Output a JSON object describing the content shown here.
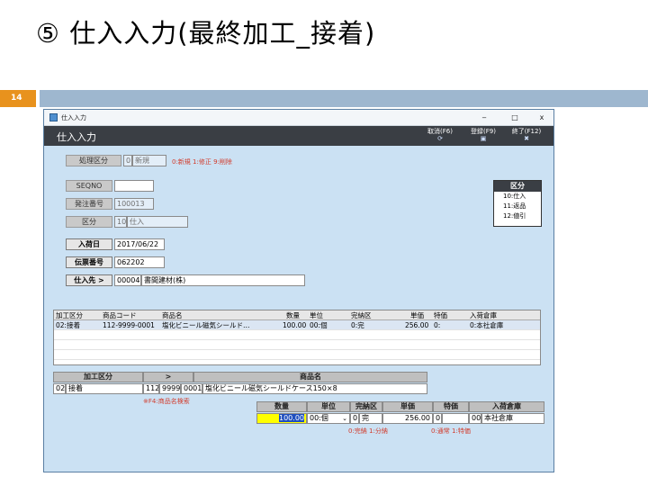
{
  "slide": {
    "title": "⑤ 仕入入力(最終加工_接着)",
    "page_number": "14"
  },
  "window": {
    "title": "仕入入力",
    "minimize": "‒",
    "maximize": "□",
    "close": "x"
  },
  "header": {
    "screen_title": "仕入入力",
    "keys": [
      {
        "label": "取消(F6)",
        "icon": "⟳"
      },
      {
        "label": "登録(F9)",
        "icon": "▣"
      },
      {
        "label": "終了(F12)",
        "icon": "✖"
      }
    ]
  },
  "form": {
    "shori_kubun": {
      "label": "処理区分",
      "code": "0",
      "name": "新規",
      "hint": "0:新規 1:修正 9:削除"
    },
    "seqno": {
      "label": "SEQNO",
      "value": ""
    },
    "order_no": {
      "label": "発注番号",
      "value": "100013"
    },
    "kubun": {
      "label": "区分",
      "code": "10",
      "name": "仕入"
    },
    "arrival_date": {
      "label": "入荷日",
      "value": "2017/06/22"
    },
    "slip_no": {
      "label": "伝票番号",
      "value": "062202"
    },
    "supplier": {
      "label": "仕入先 >",
      "code": "00004",
      "name": "書間建材(株)"
    }
  },
  "kubun_box": {
    "title": "区分",
    "items": [
      "10:仕入",
      "11:返品",
      "12:値引"
    ]
  },
  "grid": {
    "columns": [
      "加工区分",
      "商品コード",
      "商品名",
      "数量",
      "単位",
      "完納区",
      "単価",
      "特価",
      "入荷倉庫"
    ],
    "rows": [
      [
        "02:接着",
        "112-9999-0001",
        "塩化ビニール磁気シールド…",
        "100.00",
        "00:個",
        "0:完",
        "256.00",
        "0:",
        "0:本社倉庫"
      ]
    ]
  },
  "detail": {
    "kako_header": "加工区分",
    "arrow_header": ">",
    "product_header": "商品名",
    "kako_code": "02",
    "kako_name": "接着",
    "prod_code1": "112",
    "prod_code2": "9999",
    "prod_code3": "0001",
    "prod_name": "塩化ビニール磁気シールドケース150×8",
    "f4_hint": "※F4:商品名検索",
    "qty_header": "数量",
    "unit_header": "単位",
    "kannou_header": "完納区",
    "price_header": "単価",
    "tokka_header": "特価",
    "warehouse_header": "入荷倉庫",
    "qty": "100.00",
    "unit": "00:個",
    "kannou_code": "0",
    "kannou_name": "完",
    "price": "256.00",
    "tokka_code": "0",
    "tokka_name": "",
    "warehouse_code": "00",
    "warehouse_name": "本社倉庫",
    "kannou_hint": "0:完納 1:分納",
    "tokka_hint": "0:通常 1:特価"
  },
  "colors": {
    "hint": "#d23b2b",
    "header": "#3a3e44",
    "form_bg": "#cbe1f3",
    "highlight": "#ffff00",
    "page_num": "#e8921d"
  }
}
